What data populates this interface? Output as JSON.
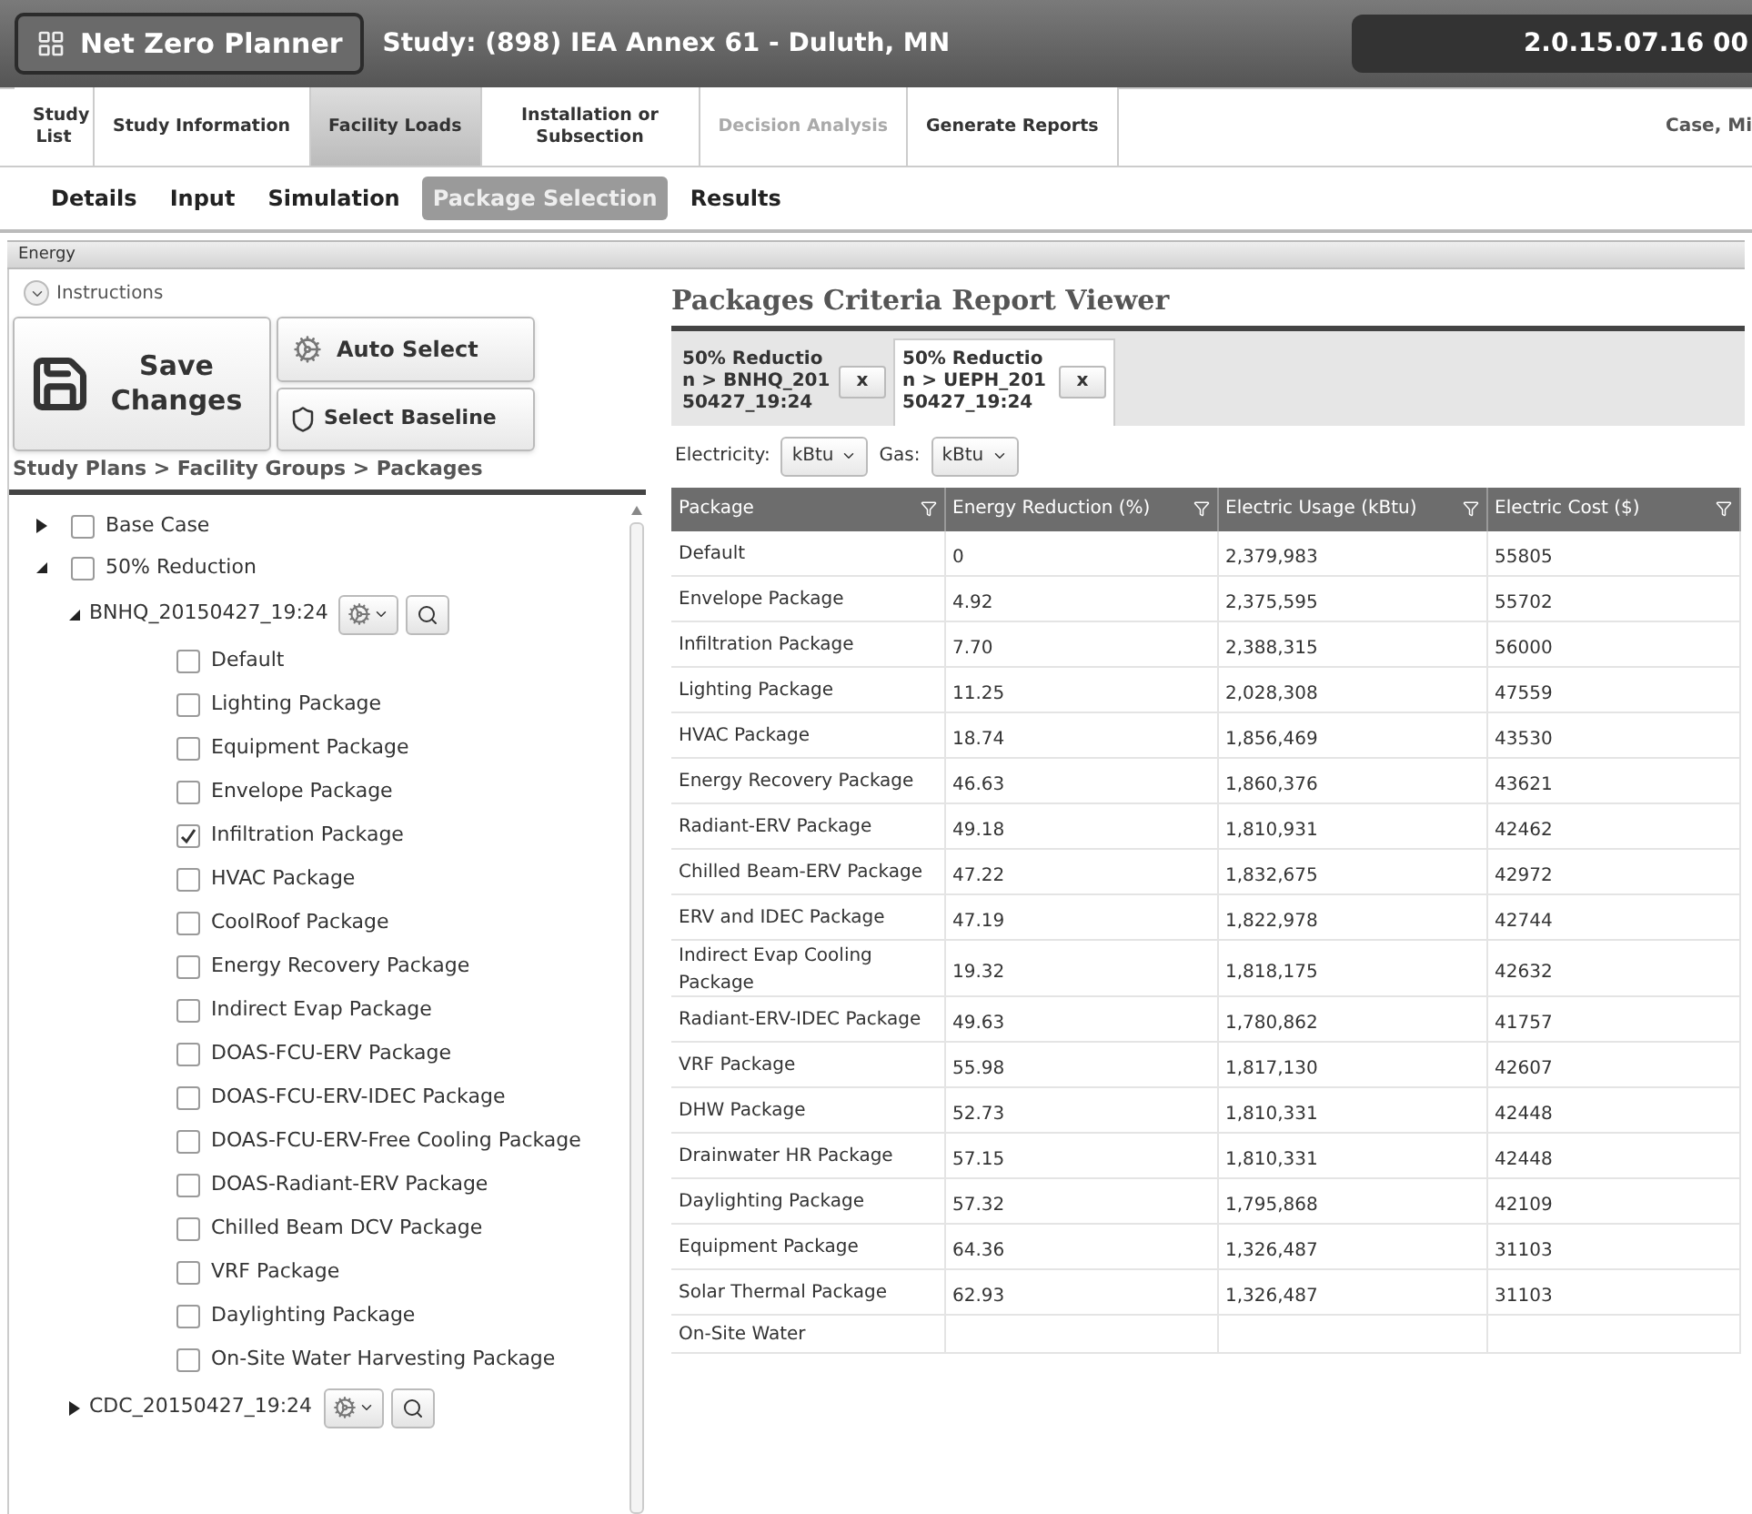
{
  "header": {
    "app_button": "Net Zero Planner",
    "study_title": "Study: (898) IEA Annex 61 - Duluth, MN",
    "version": "2.0.15.07.16 00"
  },
  "nav_tabs": [
    {
      "label": "Study List",
      "selected": false,
      "disabled": false
    },
    {
      "label": "Study Information",
      "selected": false,
      "disabled": false
    },
    {
      "label": "Facility Loads",
      "selected": true,
      "disabled": false
    },
    {
      "label": "Installation or Subsection",
      "selected": false,
      "disabled": false
    },
    {
      "label": "Decision Analysis",
      "selected": false,
      "disabled": true
    },
    {
      "label": "Generate Reports",
      "selected": false,
      "disabled": false
    }
  ],
  "user": "Case, Mi",
  "sub_tabs": [
    {
      "label": "Details",
      "selected": false
    },
    {
      "label": "Input",
      "selected": false
    },
    {
      "label": "Simulation",
      "selected": false
    },
    {
      "label": "Package Selection",
      "selected": true
    },
    {
      "label": "Results",
      "selected": false
    }
  ],
  "section_title": "Energy",
  "instructions": {
    "label": "Instructions",
    "expanded": false
  },
  "buttons": {
    "save": "Save Changes",
    "auto_select": "Auto Select",
    "select_baseline": "Select Baseline"
  },
  "breadcrumb": "Study Plans > Facility Groups > Packages",
  "tree": [
    {
      "kind": "group",
      "label": "Base Case",
      "expanded": false,
      "checked": false
    },
    {
      "kind": "group",
      "label": "50% Reduction",
      "expanded": true,
      "checked": false,
      "children": [
        {
          "kind": "run",
          "label": "BNHQ_20150427_19:24",
          "expanded": true,
          "children": [
            {
              "kind": "package",
              "label": "Default",
              "checked": false
            },
            {
              "kind": "package",
              "label": "Lighting Package",
              "checked": false
            },
            {
              "kind": "package",
              "label": "Equipment Package",
              "checked": false
            },
            {
              "kind": "package",
              "label": "Envelope Package",
              "checked": false
            },
            {
              "kind": "package",
              "label": "Infiltration Package",
              "checked": true
            },
            {
              "kind": "package",
              "label": "HVAC Package",
              "checked": false
            },
            {
              "kind": "package",
              "label": "CoolRoof Package",
              "checked": false
            },
            {
              "kind": "package",
              "label": "Energy Recovery Package",
              "checked": false
            },
            {
              "kind": "package",
              "label": "Indirect Evap Package",
              "checked": false
            },
            {
              "kind": "package",
              "label": "DOAS-FCU-ERV Package",
              "checked": false
            },
            {
              "kind": "package",
              "label": "DOAS-FCU-ERV-IDEC Package",
              "checked": false
            },
            {
              "kind": "package",
              "label": "DOAS-FCU-ERV-Free Cooling Package",
              "checked": false
            },
            {
              "kind": "package",
              "label": "DOAS-Radiant-ERV Package",
              "checked": false
            },
            {
              "kind": "package",
              "label": "Chilled Beam DCV Package",
              "checked": false
            },
            {
              "kind": "package",
              "label": "VRF Package",
              "checked": false
            },
            {
              "kind": "package",
              "label": "Daylighting Package",
              "checked": false
            },
            {
              "kind": "package",
              "label": "On-Site Water Harvesting Package",
              "checked": false
            }
          ]
        },
        {
          "kind": "run",
          "label": "CDC_20150427_19:24",
          "expanded": false
        }
      ]
    }
  ],
  "report": {
    "title": "Packages Criteria Report Viewer",
    "tabs": [
      {
        "label": "50% Reduction > BNHQ_20150427_19:24",
        "close": "x",
        "selected": false
      },
      {
        "label": "50% Reduction > UEPH_20150427_19:24",
        "close": "x",
        "selected": true
      }
    ],
    "electricity_label": "Electricity:",
    "electricity_unit": "kBtu",
    "gas_label": "Gas:",
    "gas_unit": "kBtu",
    "columns": [
      "Package",
      "Energy Reduction (%)",
      "Electric Usage (kBtu)",
      "Electric Cost ($)"
    ],
    "rows": [
      [
        "Default",
        "0",
        "2,379,983",
        "55805"
      ],
      [
        "Envelope Package",
        "4.92",
        "2,375,595",
        "55702"
      ],
      [
        "Infiltration Package",
        "7.70",
        "2,388,315",
        "56000"
      ],
      [
        "Lighting Package",
        "11.25",
        "2,028,308",
        "47559"
      ],
      [
        "HVAC Package",
        "18.74",
        "1,856,469",
        "43530"
      ],
      [
        "Energy Recovery Package",
        "46.63",
        "1,860,376",
        "43621"
      ],
      [
        "Radiant-ERV Package",
        "49.18",
        "1,810,931",
        "42462"
      ],
      [
        "Chilled Beam-ERV Package",
        "47.22",
        "1,832,675",
        "42972"
      ],
      [
        "ERV and IDEC Package",
        "47.19",
        "1,822,978",
        "42744"
      ],
      [
        "Indirect Evap Cooling Package",
        "19.32",
        "1,818,175",
        "42632"
      ],
      [
        "Radiant-ERV-IDEC Package",
        "49.63",
        "1,780,862",
        "41757"
      ],
      [
        "VRF Package",
        "55.98",
        "1,817,130",
        "42607"
      ],
      [
        "DHW Package",
        "52.73",
        "1,810,331",
        "42448"
      ],
      [
        "Drainwater HR Package",
        "57.15",
        "1,810,331",
        "42448"
      ],
      [
        "Daylighting Package",
        "57.32",
        "1,795,868",
        "42109"
      ],
      [
        "Equipment Package",
        "64.36",
        "1,326,487",
        "31103"
      ],
      [
        "Solar Thermal Package",
        "62.93",
        "1,326,487",
        "31103"
      ],
      [
        "On-Site Water",
        "",
        "",
        ""
      ]
    ]
  }
}
